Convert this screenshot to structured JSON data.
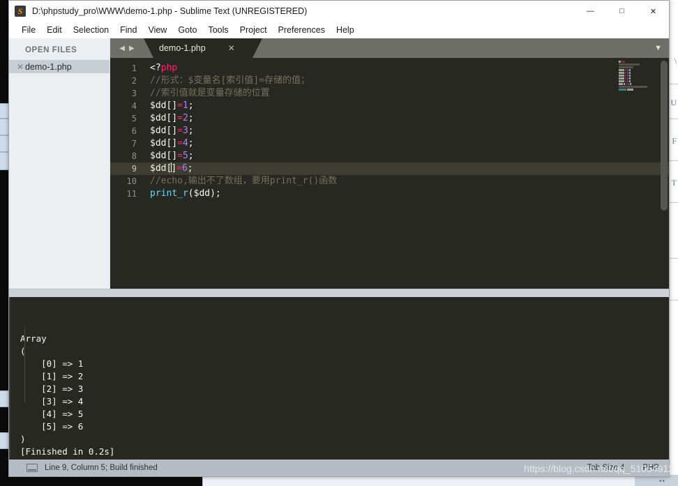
{
  "window": {
    "title": "D:\\phpstudy_pro\\WWW\\demo-1.php - Sublime Text (UNREGISTERED)",
    "app_icon": "sublime-logo-icon",
    "controls": {
      "minimize": "—",
      "maximize": "□",
      "close": "✕"
    }
  },
  "menubar": {
    "items": [
      "File",
      "Edit",
      "Selection",
      "Find",
      "View",
      "Goto",
      "Tools",
      "Project",
      "Preferences",
      "Help"
    ]
  },
  "sidebar": {
    "header": "OPEN FILES",
    "files": [
      {
        "name": "demo-1.php",
        "close": "✕",
        "selected": true
      }
    ]
  },
  "tabbar": {
    "nav_prev": "◀",
    "nav_next": "▶",
    "tabs": [
      {
        "label": "demo-1.php",
        "close": "✕",
        "active": true
      }
    ],
    "chevron": "▼"
  },
  "editor": {
    "line_numbers": [
      "1",
      "2",
      "3",
      "4",
      "5",
      "6",
      "7",
      "8",
      "9",
      "10",
      "11"
    ],
    "active_line": 9,
    "lines": [
      {
        "n": 1,
        "tokens": [
          {
            "t": "<?",
            "c": "white"
          },
          {
            "t": "php",
            "c": "php"
          }
        ]
      },
      {
        "n": 2,
        "tokens": [
          {
            "t": "//形式：$变量名[索引值]=存储的值；",
            "c": "comment"
          }
        ]
      },
      {
        "n": 3,
        "tokens": [
          {
            "t": "//索引值就是变量存储的位置",
            "c": "comment"
          }
        ]
      },
      {
        "n": 4,
        "tokens": [
          {
            "t": "$dd[]",
            "c": "white"
          },
          {
            "t": "=",
            "c": "kw"
          },
          {
            "t": "1",
            "c": "num"
          },
          {
            "t": ";",
            "c": "white"
          }
        ]
      },
      {
        "n": 5,
        "tokens": [
          {
            "t": "$dd[]",
            "c": "white"
          },
          {
            "t": "=",
            "c": "kw"
          },
          {
            "t": "2",
            "c": "num"
          },
          {
            "t": ";",
            "c": "white"
          }
        ]
      },
      {
        "n": 6,
        "tokens": [
          {
            "t": "$dd[]",
            "c": "white"
          },
          {
            "t": "=",
            "c": "kw"
          },
          {
            "t": "3",
            "c": "num"
          },
          {
            "t": ";",
            "c": "white"
          }
        ]
      },
      {
        "n": 7,
        "tokens": [
          {
            "t": "$dd[]",
            "c": "white"
          },
          {
            "t": "=",
            "c": "kw"
          },
          {
            "t": "4",
            "c": "num"
          },
          {
            "t": ";",
            "c": "white"
          }
        ]
      },
      {
        "n": 8,
        "tokens": [
          {
            "t": "$dd[]",
            "c": "white"
          },
          {
            "t": "=",
            "c": "kw"
          },
          {
            "t": "5",
            "c": "num"
          },
          {
            "t": ";",
            "c": "white"
          }
        ]
      },
      {
        "n": 9,
        "tokens": [
          {
            "t": "$dd[",
            "c": "white"
          },
          {
            "t": "CARET",
            "c": "caret"
          },
          {
            "t": "]",
            "c": "white"
          },
          {
            "t": "=",
            "c": "kw"
          },
          {
            "t": "6",
            "c": "num"
          },
          {
            "t": ";",
            "c": "white"
          }
        ]
      },
      {
        "n": 10,
        "tokens": [
          {
            "t": "//echo,输出不了数组，要用print_r()函数",
            "c": "comment"
          }
        ]
      },
      {
        "n": 11,
        "tokens": [
          {
            "t": "print_r",
            "c": "fn"
          },
          {
            "t": "($dd);",
            "c": "white"
          }
        ]
      }
    ]
  },
  "console": {
    "lines": [
      "Array",
      "(",
      "    [0] => 1",
      "    [1] => 2",
      "    [2] => 3",
      "    [3] => 4",
      "    [4] => 5",
      "    [5] => 6",
      ")",
      "[Finished in 0.2s]"
    ]
  },
  "statusbar": {
    "icon": "monitor-icon",
    "message": "Line 9, Column 5; Build finished",
    "tab_size": "Tab Size 4",
    "syntax": "PHP"
  },
  "watermark": {
    "text": "https://blog.csdn.net/qq_51054912"
  },
  "colors": {
    "editor_bg": "#272822",
    "active_line": "#3e3d32",
    "comment": "#75715e",
    "keyword": "#f92672",
    "number": "#ae81ff",
    "function": "#66d9ef",
    "text": "#f8f8f2",
    "tabbar_bg": "#6f6f6a",
    "sidebar_bg": "#eceff1",
    "statusbar_bg": "#b6bcc3"
  }
}
